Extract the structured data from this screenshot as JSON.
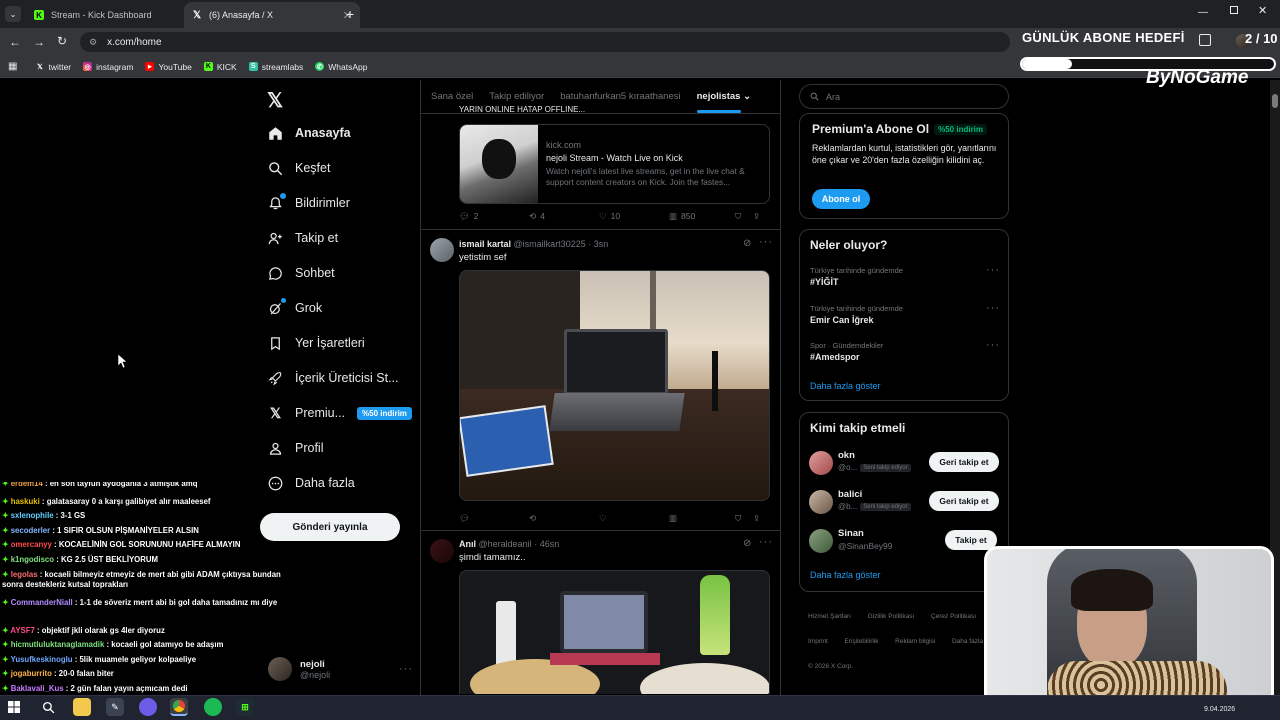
{
  "browser": {
    "tabs": [
      {
        "title": "Stream - Kick Dashboard",
        "icon": "kick-icon"
      },
      {
        "title": "(6) Anasayfa / X",
        "icon": "x-icon"
      }
    ],
    "url": "x.com/home",
    "bookmarks": [
      {
        "label": "twitter",
        "icon": "x-icon"
      },
      {
        "label": "instagram",
        "icon": "instagram-icon"
      },
      {
        "label": "YouTube",
        "icon": "youtube-icon"
      },
      {
        "label": "KICK",
        "icon": "kick-icon"
      },
      {
        "label": "streamlabs",
        "icon": "streamlabs-icon"
      },
      {
        "label": "WhatsApp",
        "icon": "whatsapp-icon"
      }
    ]
  },
  "overlay": {
    "goal_title": "GÜNLÜK ABONE HEDEFİ",
    "goal_count": "2 / 10",
    "goal_progress": 0.2,
    "brand": "ByNoGame"
  },
  "nav": {
    "items": [
      {
        "label": "Anasayfa",
        "icon": "home-icon"
      },
      {
        "label": "Keşfet",
        "icon": "search-icon"
      },
      {
        "label": "Bildirimler",
        "icon": "bell-icon"
      },
      {
        "label": "Takip et",
        "icon": "person-add-icon"
      },
      {
        "label": "Sohbet",
        "icon": "chat-icon"
      },
      {
        "label": "Grok",
        "icon": "grok-icon"
      },
      {
        "label": "Yer İşaretleri",
        "icon": "bookmark-icon"
      },
      {
        "label": "İçerik Üreticisi St...",
        "icon": "rocket-icon"
      },
      {
        "label": "Premiu...",
        "icon": "x-icon"
      },
      {
        "label": "Profil",
        "icon": "person-icon"
      },
      {
        "label": "Daha fazla",
        "icon": "more-circle-icon"
      }
    ],
    "premium_badge": "%50 indirim",
    "post_button": "Gönderi yayınla",
    "profile": {
      "name": "nejoli",
      "handle": "@nejoli"
    }
  },
  "chat": [
    {
      "user": "erdem14",
      "text": "en son tayfun aydoganla 3 atmıştık amq",
      "color": "#f0a04b"
    },
    {
      "user": "haskuki",
      "text": "galatasaray 0 a karşı galibiyet alır maaleesef",
      "color": "#e5c100"
    },
    {
      "user": "sxlenophile",
      "text": "3-1 GS",
      "color": "#5fd0ff"
    },
    {
      "user": "secoderler",
      "text": "1 SIFIR OLSUN PİŞMANİYELER ALSIN",
      "color": "#7fb6ff"
    },
    {
      "user": "omercanyy",
      "text": "KOCAELİNİN GOL SORUNUNU HAFİFE ALMAYIN",
      "color": "#ff4b4b"
    },
    {
      "user": "k1ngodisco",
      "text": "KG 2.5 ÜST BEKLİYORUM",
      "color": "#7ee07e"
    },
    {
      "user": "legolas",
      "text": "kocaeli bilmeyiz etmeyiz de mert abi gibi ADAM çıktıysa bundan sonra destekleriz kutsal toprakları",
      "color": "#ff6b6b"
    },
    {
      "user": "CommanderNiall",
      "text": "1-1 de söveriz merrt abi bi gol daha tamadınız mı diye",
      "color": "#b48cff"
    },
    {
      "user": "AYSF7",
      "text": "objektif jkli olarak gs 4ler diyoruz",
      "color": "#ff4b8b"
    },
    {
      "user": "hicmutluluktanaglamadik",
      "text": "kocaeli gol atamıyo be adaşım",
      "color": "#7ee07e"
    },
    {
      "user": "Yusufkeskinoglu",
      "text": "5lik muamele geliyor kolpaeliye",
      "color": "#6fa8ff"
    },
    {
      "user": "jogaburrito",
      "text": "20-0 falan biter",
      "color": "#ffb347"
    },
    {
      "user": "Baklavali_Kus",
      "text": "2 gün falan yayın açmıcam dedi",
      "color": "#c77dff"
    }
  ],
  "timeline": {
    "tabs": [
      "Sana özel",
      "Takip ediliyor",
      "batuhanfurkan5 kıraathanesi",
      "nejolistas"
    ],
    "card": {
      "cut_text": "YARIN ONLINE HATAP OFFLINE...",
      "domain": "kick.com",
      "title": "nejoli Stream - Watch Live on Kick",
      "desc": "Watch nejoli's latest live streams, get in the live chat & support content creators on Kick. Join the fastes..."
    },
    "post0_stats": {
      "replies": "2",
      "reposts": "4",
      "likes": "10",
      "views": "850"
    },
    "posts": [
      {
        "name": "ismail kartal",
        "handle": "@ismailkart30225",
        "time": "3sn",
        "text": "yetistim sef"
      },
      {
        "name": "Anıl",
        "handle": "@heraldeanil",
        "time": "46sn",
        "text": "şimdi tamamız.."
      }
    ]
  },
  "right": {
    "search_placeholder": "Ara",
    "premium": {
      "title": "Premium'a Abone Ol",
      "badge": "%50 indirim",
      "text": "Reklamlardan kurtul, istatistikleri gör, yanıtlarını öne çıkar ve 20'den fazla özelliğin kilidini aç.",
      "button": "Abone ol"
    },
    "trends_title": "Neler oluyor?",
    "trends": [
      {
        "cat": "Türkiye tarihinde gündemde",
        "name": "#YİĞİT"
      },
      {
        "cat": "Türkiye tarihinde gündemde",
        "name": "Emir Can İğrek"
      },
      {
        "cat": "Spor · Gündemdekiler",
        "name": "#Amedspor"
      }
    ],
    "show_more": "Daha fazla göster",
    "who_title": "Kimi takip etmeli",
    "who": [
      {
        "name": "okn",
        "handle": "@o...",
        "tag": "Seni takip ediyor",
        "button": "Geri takip et"
      },
      {
        "name": "balici",
        "handle": "@b...",
        "tag": "Seni takip ediyor",
        "button": "Geri takip et"
      },
      {
        "name": "Sinan",
        "handle": "@SinanBey99",
        "tag": "",
        "button": "Takip et"
      }
    ],
    "who_more": "Daha fazla göster",
    "footer": [
      "Hizmet Şartları",
      "Gizlilik Politikası",
      "Çerez Politikası",
      "Imprint",
      "Erişilebilirlik",
      "Reklam bilgisi",
      "Daha fazla ...",
      "© 2026 X Corp."
    ]
  },
  "taskbar": {
    "date": "9.04.2026"
  }
}
